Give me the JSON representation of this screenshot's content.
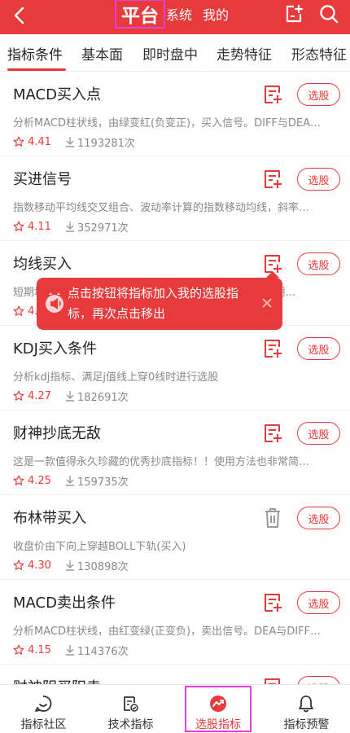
{
  "header": {
    "tabs": [
      {
        "label": "平台",
        "active": true
      },
      {
        "label": "系统",
        "active": false
      },
      {
        "label": "我的",
        "active": false
      }
    ],
    "icons": [
      "back-icon",
      "add-note-icon",
      "search-icon"
    ]
  },
  "subtabs": [
    {
      "label": "指标条件",
      "active": true
    },
    {
      "label": "基本面",
      "active": false
    },
    {
      "label": "即时盘中",
      "active": false
    },
    {
      "label": "走势特征",
      "active": false
    },
    {
      "label": "形态特征",
      "active": false
    }
  ],
  "items": [
    {
      "title": "MACD买入点",
      "desc": "分析MACD柱状线，由绿变红(负变正)，买入信号。DIFF与DEA…",
      "rating": "4.41",
      "count": "1193281次",
      "action_icon": "add-note-icon",
      "select_label": "选股"
    },
    {
      "title": "买进信号",
      "desc": "指数移动平均线交叉组合、波动率计算的指数移动均线，斜率…",
      "rating": "4.11",
      "count": "352971次",
      "action_icon": "add-note-icon",
      "select_label": "选股"
    },
    {
      "title": "均线买入",
      "desc": "短期均线上穿长期均线时产生买入信号，参数SHORT,长期…",
      "rating": "4.18",
      "count": "",
      "action_icon": "add-note-icon",
      "select_label": "选股"
    },
    {
      "title": "KDJ买入条件",
      "desc": "分析kdj指标、满足j值线上穿0线时进行选股",
      "rating": "4.27",
      "count": "182691次",
      "action_icon": "add-note-icon",
      "select_label": "选股"
    },
    {
      "title": "财神抄底无敌",
      "desc": "这是一款值得永久珍藏的优秀抄底指标！！使用方法也非常简…",
      "rating": "4.25",
      "count": "159735次",
      "action_icon": "add-note-icon",
      "select_label": "选股"
    },
    {
      "title": "布林带买入",
      "desc": "收盘价由下向上穿越BOLL下轨(买入)",
      "rating": "4.30",
      "count": "130898次",
      "action_icon": "trash-icon",
      "select_label": "选股"
    },
    {
      "title": "MACD卖出条件",
      "desc": "分析MACD柱状线，由红变绿(正变负)，卖出信号。DEA与DIFF…",
      "rating": "4.15",
      "count": "114376次",
      "action_icon": "add-note-icon",
      "select_label": "选股"
    },
    {
      "title": "财神阴买阳卖",
      "desc": "",
      "rating": "",
      "count": "",
      "action_icon": "add-note-icon",
      "select_label": "选股"
    }
  ],
  "tooltip": {
    "text": "点击按钮将指标加入我的选股指标，再次点击移出",
    "icon": "megaphone-icon",
    "close_icon": "close-icon"
  },
  "bottom_nav": [
    {
      "label": "指标社区",
      "icon": "community-icon",
      "active": false
    },
    {
      "label": "技术指标",
      "icon": "indicator-icon",
      "active": false
    },
    {
      "label": "选股指标",
      "icon": "stock-pick-icon",
      "active": true
    },
    {
      "label": "指标预警",
      "icon": "bell-icon",
      "active": false
    }
  ],
  "colors": {
    "accent": "#e83a3a",
    "highlight": "#e040e0"
  }
}
